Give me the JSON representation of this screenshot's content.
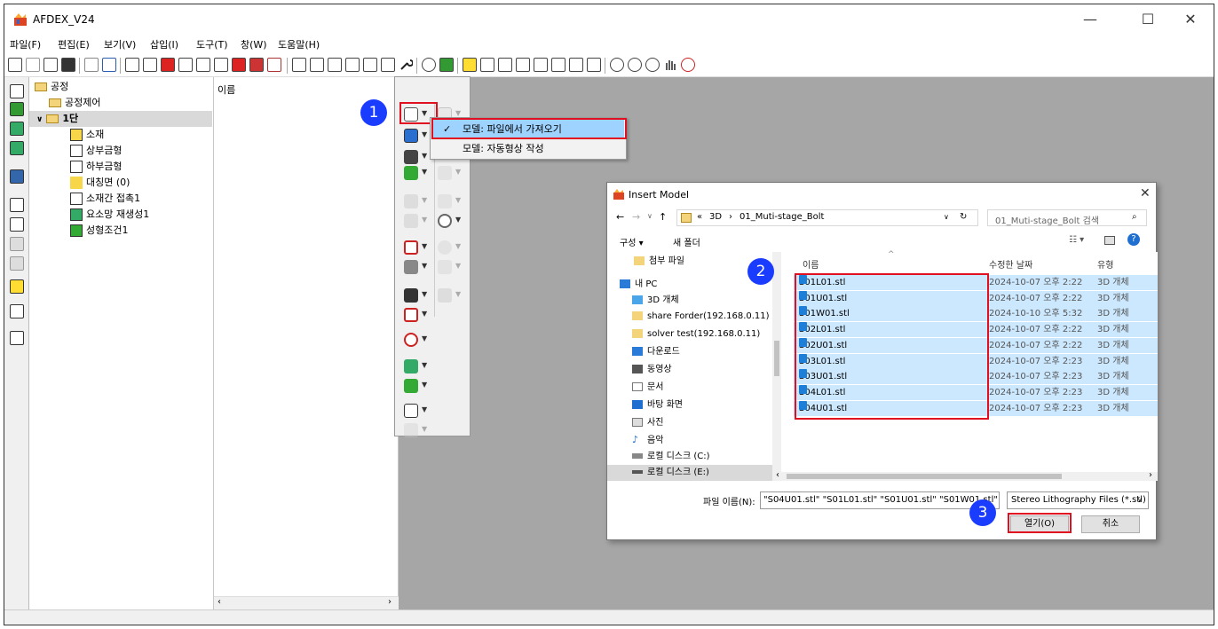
{
  "app": {
    "title": "AFDEX_V24"
  },
  "window_controls": {
    "minimize": "—",
    "maximize": "☐",
    "close": "✕"
  },
  "menu": [
    "파일(F)",
    "편집(E)",
    "보기(V)",
    "삽입(I)",
    "도구(T)",
    "창(W)",
    "도움말(H)"
  ],
  "tree": {
    "items": [
      {
        "label": "공정"
      },
      {
        "label": "공정제어"
      },
      {
        "label": "1단"
      },
      {
        "label": "소재"
      },
      {
        "label": "상부금형"
      },
      {
        "label": "하부금형"
      },
      {
        "label": "대칭면 (0)"
      },
      {
        "label": "소재간 접촉1"
      },
      {
        "label": "요소망 재생성1"
      },
      {
        "label": "성형조건1"
      }
    ]
  },
  "name_panel": {
    "header": "이름"
  },
  "dropdown": {
    "items": [
      {
        "label": "모델: 파일에서 가져오기",
        "checked": true
      },
      {
        "label": "모델: 자동형상 작성",
        "checked": false
      }
    ]
  },
  "markers": [
    "1",
    "2",
    "3"
  ],
  "dialog": {
    "title": "Insert Model",
    "close": "✕",
    "breadcrumb": [
      "«",
      "3D",
      "›",
      "01_Muti-stage_Bolt"
    ],
    "search_placeholder": "01_Muti-stage_Bolt 검색",
    "organize": "구성 ▾",
    "new_folder": "새 폴더",
    "nav_items": [
      {
        "label": "첨부 파일",
        "icon": "folder-icon"
      },
      {
        "label": "내 PC",
        "icon": "pc-icon"
      },
      {
        "label": "3D 개체",
        "icon": "3d-objects-icon"
      },
      {
        "label": "share Forder(192.168.0.11)",
        "icon": "network-drive-icon"
      },
      {
        "label": "solver test(192.168.0.11)",
        "icon": "network-drive-icon"
      },
      {
        "label": "다운로드",
        "icon": "download-icon"
      },
      {
        "label": "동영상",
        "icon": "video-icon"
      },
      {
        "label": "문서",
        "icon": "document-icon"
      },
      {
        "label": "바탕 화면",
        "icon": "desktop-icon"
      },
      {
        "label": "사진",
        "icon": "picture-icon"
      },
      {
        "label": "음악",
        "icon": "music-icon"
      },
      {
        "label": "로컬 디스크 (C:)",
        "icon": "disk-icon"
      },
      {
        "label": "로컬 디스크 (E:)",
        "icon": "disk-icon"
      }
    ],
    "columns": {
      "name": "이름",
      "modified": "수정한 날짜",
      "type": "유형"
    },
    "files": [
      {
        "name": "S01L01.stl",
        "modified": "2024-10-07 오후 2:22",
        "type": "3D 개체"
      },
      {
        "name": "S01U01.stl",
        "modified": "2024-10-07 오후 2:22",
        "type": "3D 개체"
      },
      {
        "name": "S01W01.stl",
        "modified": "2024-10-10 오후 5:32",
        "type": "3D 개체"
      },
      {
        "name": "S02L01.stl",
        "modified": "2024-10-07 오후 2:22",
        "type": "3D 개체"
      },
      {
        "name": "S02U01.stl",
        "modified": "2024-10-07 오후 2:22",
        "type": "3D 개체"
      },
      {
        "name": "S03L01.stl",
        "modified": "2024-10-07 오후 2:23",
        "type": "3D 개체"
      },
      {
        "name": "S03U01.stl",
        "modified": "2024-10-07 오후 2:23",
        "type": "3D 개체"
      },
      {
        "name": "S04L01.stl",
        "modified": "2024-10-07 오후 2:23",
        "type": "3D 개체"
      },
      {
        "name": "S04U01.stl",
        "modified": "2024-10-07 오후 2:23",
        "type": "3D 개체"
      }
    ],
    "filename_label": "파일 이름(N):",
    "filename_value": "\"S04U01.stl\" \"S01L01.stl\" \"S01U01.stl\" \"S01W01.stl\"",
    "filetype": "Stereo Lithography Files (*.stl)",
    "open_button": "열기(O)",
    "cancel_button": "취소"
  },
  "colors": {
    "marker": "#1a3cff",
    "highlight_box": "#e01020",
    "selection": "#cce8ff",
    "workspace": "#a6a6a6"
  }
}
